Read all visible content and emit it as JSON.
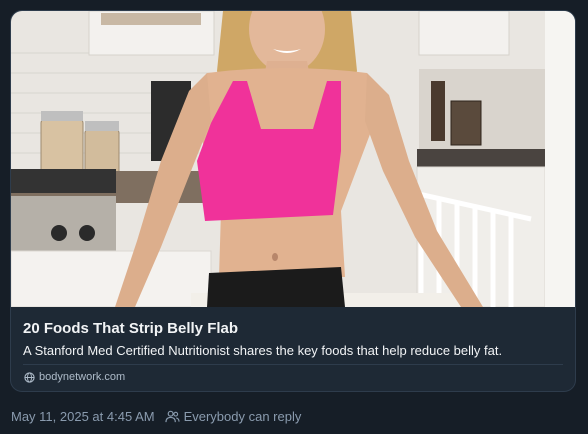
{
  "link_card": {
    "image_alt": "Woman in a pink sports bra standing in a kitchen",
    "title": "20 Foods That Strip Belly Flab",
    "description": "A Stanford Med Certified Nutritionist shares the key foods that help reduce belly fat.",
    "domain": "bodynetwork.com",
    "domain_icon": "globe-icon"
  },
  "post_meta": {
    "timestamp": "May 11, 2025 at 4:45 AM",
    "reply_icon": "people-icon",
    "reply_setting": "Everybody can reply"
  },
  "colors": {
    "background": "#161e27",
    "card_border": "#2e3c4c",
    "card_text": "#f1f3f5",
    "muted_text": "#8a9bae",
    "bra_pink": "#f0329a"
  }
}
